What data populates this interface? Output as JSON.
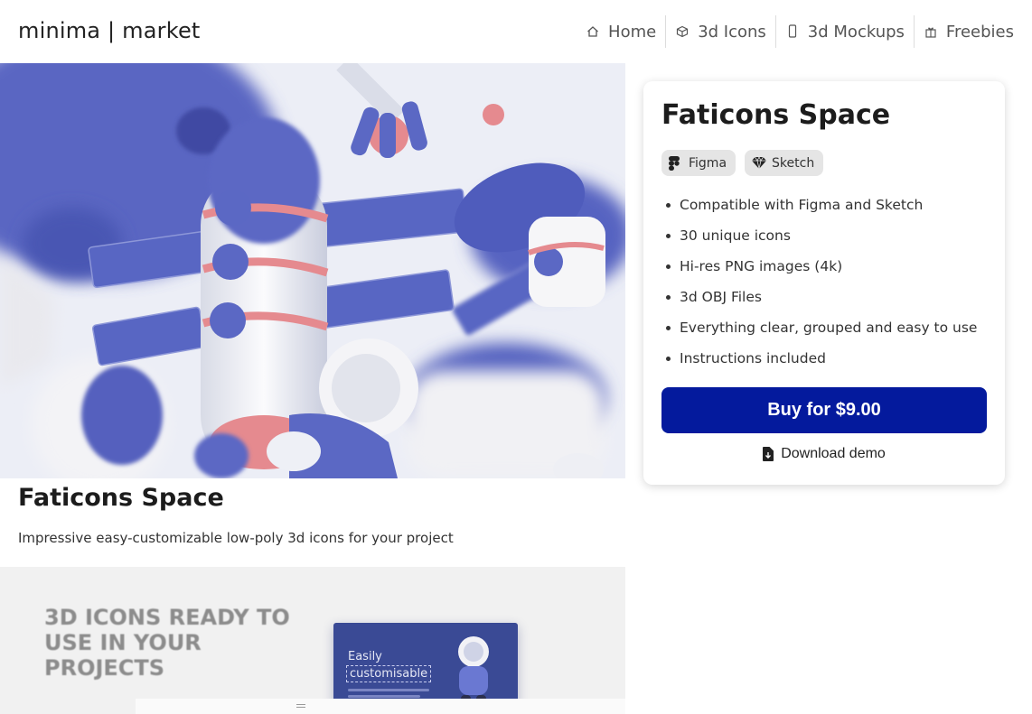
{
  "header": {
    "brand": "minima | market",
    "nav": [
      {
        "label": "Home",
        "icon": "home-icon"
      },
      {
        "label": "3d Icons",
        "icon": "cube-icon"
      },
      {
        "label": "3d Mockups",
        "icon": "phone-icon"
      },
      {
        "label": "Freebies",
        "icon": "gift-icon"
      }
    ]
  },
  "product": {
    "title": "Faticons Space",
    "description": "Impressive easy-customizable low-poly 3d icons for your project"
  },
  "preview2": {
    "headline": "3D ICONS READY TO USE IN YOUR PROJECTS",
    "mock_line1": "Easily",
    "mock_line2": "customisable"
  },
  "card": {
    "title": "Faticons Space",
    "tags": [
      {
        "label": "Figma",
        "icon": "figma-icon"
      },
      {
        "label": "Sketch",
        "icon": "sketch-diamond-icon"
      }
    ],
    "features": [
      "Compatible with Figma and Sketch",
      "30 unique icons",
      "Hi-res PNG images (4k)",
      "3d OBJ Files",
      "Everything clear, grouped and easy to use",
      "Instructions included"
    ],
    "buy_label": "Buy for $9.00",
    "demo_label": "Download demo"
  },
  "colors": {
    "accent": "#041a9d",
    "hero_blue": "#5b68c4",
    "hero_coral": "#e58a8f"
  }
}
